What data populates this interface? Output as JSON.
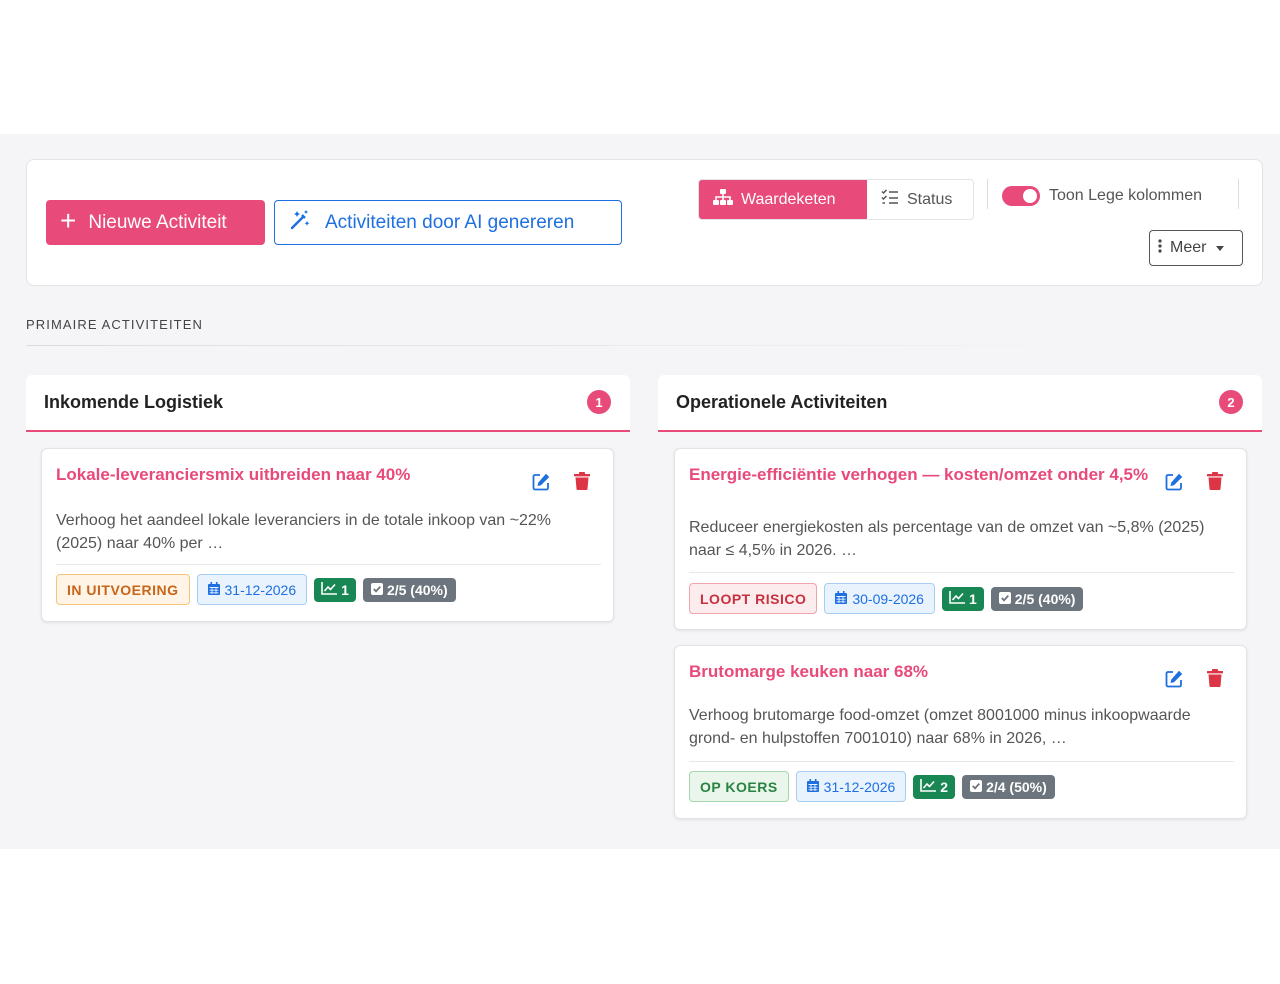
{
  "toolbar": {
    "new_activity_label": "Nieuwe Activiteit",
    "ai_generate_label": "Activiteiten door AI genereren",
    "view_valuechain_label": "Waardeketen",
    "view_status_label": "Status",
    "toggle_label": "Toon Lege kolommen",
    "toggle_on": true,
    "more_label": "Meer"
  },
  "section": {
    "title": "PRIMAIRE ACTIVITEITEN"
  },
  "columns": [
    {
      "title": "Inkomende Logistiek",
      "count": "1",
      "cards": [
        {
          "title": "Lokale-leveranciersmix uitbreiden naar 40%",
          "description": "Verhoog het aandeel lokale leveranciers in de totale inkoop van ~22% (2025) naar 40% per …",
          "status": "IN UITVOERING",
          "date": "31-12-2026",
          "kpi_count": "1",
          "tasks": "2/5 (40%)"
        }
      ]
    },
    {
      "title": "Operationele Activiteiten",
      "count": "2",
      "cards": [
        {
          "title": "Energie-efficiëntie verhogen — kosten/omzet onder 4,5%",
          "description": "Reduceer energiekosten als percentage van de omzet van ~5,8% (2025) naar ≤ 4,5% in 2026. …",
          "status": "LOOPT RISICO",
          "date": "30-09-2026",
          "kpi_count": "1",
          "tasks": "2/5 (40%)"
        },
        {
          "title": "Brutomarge keuken naar 68%",
          "description": "Verhoog brutomarge food-omzet (omzet 8001000 minus inkoopwaarde grond- en hulpstoffen 7001010) naar 68% in 2026, …",
          "status": "OP KOERS",
          "date": "31-12-2026",
          "kpi_count": "2",
          "tasks": "2/4 (50%)"
        }
      ]
    }
  ],
  "colors": {
    "accent": "#e84a7a",
    "link_blue": "#1e6fe0",
    "delete_red": "#dc3545",
    "kpi_green": "#198754",
    "task_gray": "#6c757d"
  }
}
